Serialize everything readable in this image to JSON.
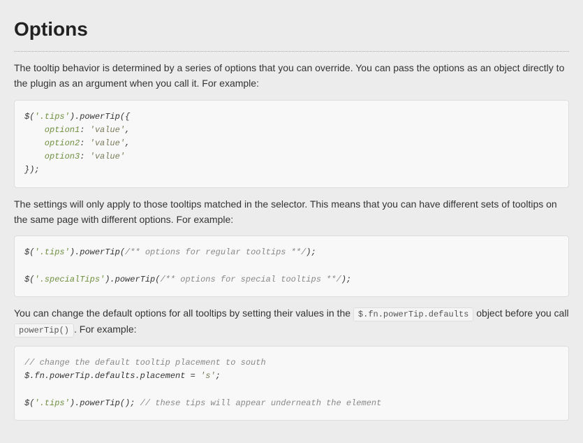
{
  "heading": "Options",
  "para1": "The tooltip behavior is determined by a series of options that you can override. You can pass the options as an object directly to the plugin as an argument when you call it. For example:",
  "code1": {
    "l1a": "$(",
    "l1b": "'.tips'",
    "l1c": ").powerTip({",
    "l2a": "    option1",
    "l2b": ": ",
    "l2c": "'value'",
    "l2d": ",",
    "l3a": "    option2",
    "l3b": ": ",
    "l3c": "'value'",
    "l3d": ",",
    "l4a": "    option3",
    "l4b": ": ",
    "l4c": "'value'",
    "l5": "});"
  },
  "para2": "The settings will only apply to those tooltips matched in the selector. This means that you can have different sets of tooltips on the same page with different options. For example:",
  "code2": {
    "l1a": "$(",
    "l1b": "'.tips'",
    "l1c": ").powerTip(",
    "l1d": "/** options for regular tooltips **/",
    "l1e": ");",
    "l2a": "$(",
    "l2b": "'.specialTips'",
    "l2c": ").powerTip(",
    "l2d": "/** options for special tooltips **/",
    "l2e": ");"
  },
  "para3a": "You can change the default options for all tooltips by setting their values in the ",
  "para3_code1": "$.fn.powerTip.defaults",
  "para3b": " object before you call ",
  "para3_code2": "powerTip()",
  "para3c": ". For example:",
  "code3": {
    "l1": "// change the default tooltip placement to south",
    "l2a": "$.fn.powerTip.defaults.placement = ",
    "l2b": "'s'",
    "l2c": ";",
    "l3a": "$(",
    "l3b": "'.tips'",
    "l3c": ").powerTip(); ",
    "l3d": "// these tips will appear underneath the element"
  }
}
